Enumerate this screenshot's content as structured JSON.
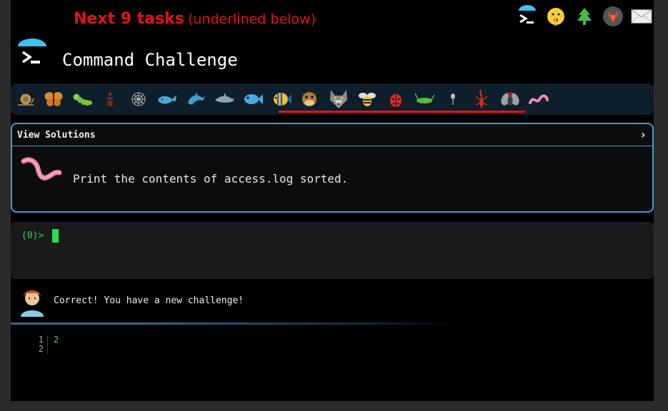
{
  "header": {
    "next_tasks": "Next 9 tasks",
    "next_tasks_note": "(underlined below)",
    "title": "Command Challenge"
  },
  "top_icons": [
    "terminal-icon",
    "shushing-face-icon",
    "evergreen-tree-icon",
    "gitlab-icon",
    "envelope-icon"
  ],
  "task_icons": [
    "snail-icon",
    "butterfly-icon",
    "caterpillar-icon",
    "ant-icon",
    "spider-web-icon",
    "whale-icon",
    "dolphin-icon",
    "dolphin-icon",
    "fish-icon",
    "tropical-fish-icon",
    "blowfish-icon",
    "wolf-icon",
    "bee-icon",
    "ladybug-icon",
    "cricket-icon",
    "mosquito-icon",
    "scorpion-icon",
    "fly-icon",
    "worm-icon"
  ],
  "solutions": {
    "header_label": "View Solutions",
    "chevron": "›",
    "task_icon": "worm-icon",
    "task_text": "Print the contents of access.log sorted."
  },
  "terminal": {
    "prompt": "(0)>"
  },
  "feedback": {
    "message": "Correct! You have a new challenge!",
    "avatar": "man-technologist-icon"
  },
  "output": {
    "line_numbers": [
      "1",
      "2"
    ],
    "lines": [
      "2",
      ""
    ]
  },
  "colors": {
    "accent_red": "#e01414",
    "panel_border": "#3d9fd0",
    "prompt_green": "#31d35a",
    "cursor_green": "#22e34a"
  }
}
